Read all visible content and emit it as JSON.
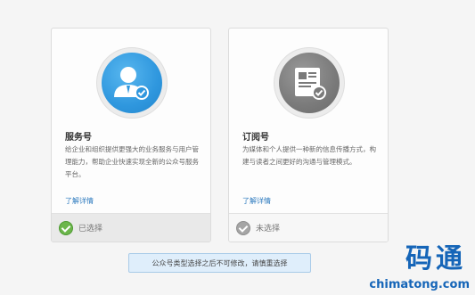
{
  "cards": [
    {
      "title": "服务号",
      "description": "给企业和组织提供更强大的业务服务与用户管理能力，帮助企业快速实现全新的公众号服务平台。",
      "link": "了解详情",
      "status": "已选择",
      "icon": "person-check-icon",
      "color": "#2f97de"
    },
    {
      "title": "订阅号",
      "description": "为媒体和个人提供一种新的信息传播方式，构建与读者之间更好的沟通与管理模式。",
      "link": "了解详情",
      "status": "未选择",
      "icon": "document-check-icon",
      "color": "#7a7a7a"
    }
  ],
  "notice": "公众号类型选择之后不可修改，请慎重选择",
  "watermark": {
    "logo": "码通",
    "url": "chimatong.com"
  },
  "colors": {
    "selected_check": "#6cb64b",
    "link": "#2e7bbf",
    "notice_bg": "#dfeefb"
  }
}
